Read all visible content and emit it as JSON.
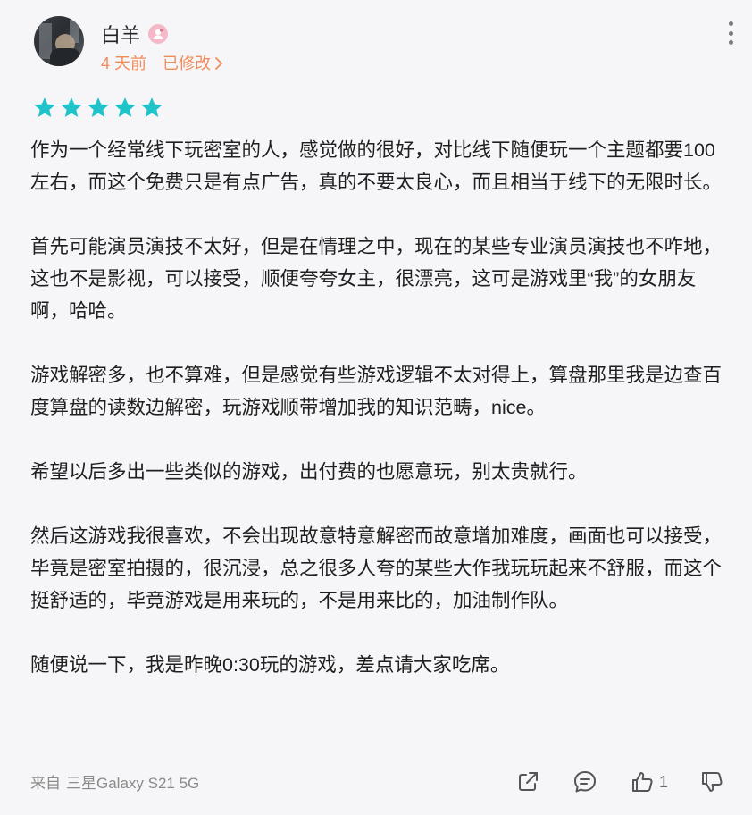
{
  "user": {
    "name": "白羊",
    "time": "4 天前",
    "edited_label": "已修改"
  },
  "rating": {
    "stars": 5,
    "max": 5,
    "color": "#20c4c8"
  },
  "review": {
    "paragraphs": [
      "作为一个经常线下玩密室的人，感觉做的很好，对比线下随便玩一个主题都要100左右，而这个免费只是有点广告，真的不要太良心，而且相当于线下的无限时长。",
      "首先可能演员演技不太好，但是在情理之中，现在的某些专业演员演技也不咋地，这也不是影视，可以接受，顺便夸夸女主，很漂亮，这可是游戏里“我”的女朋友啊，哈哈。",
      "游戏解密多，也不算难，但是感觉有些游戏逻辑不太对得上，算盘那里我是边查百度算盘的读数边解密，玩游戏顺带增加我的知识范畴，nice。",
      "希望以后多出一些类似的游戏，出付费的也愿意玩，别太贵就行。",
      "然后这游戏我很喜欢，不会出现故意特意解密而故意增加难度，画面也可以接受，毕竟是密室拍摄的，很沉浸，总之很多人夸的某些大作我玩玩起来不舒服，而这个挺舒适的，毕竟游戏是用来玩的，不是用来比的，加油制作队。",
      "随便说一下，我是昨晚0:30玩的游戏，差点请大家吃席。"
    ]
  },
  "footer": {
    "source_prefix": "来自",
    "device": "三星Galaxy S21 5G",
    "like_count": "1"
  },
  "colors": {
    "accent_orange": "#f08c5a",
    "star_teal": "#20c4c8",
    "badge_pink": "#f4b9c8"
  },
  "icons": [
    "more-vertical-icon",
    "share-icon",
    "comment-icon",
    "thumbs-up-icon",
    "thumbs-down-icon",
    "chevron-right-icon",
    "user-badge-icon"
  ]
}
